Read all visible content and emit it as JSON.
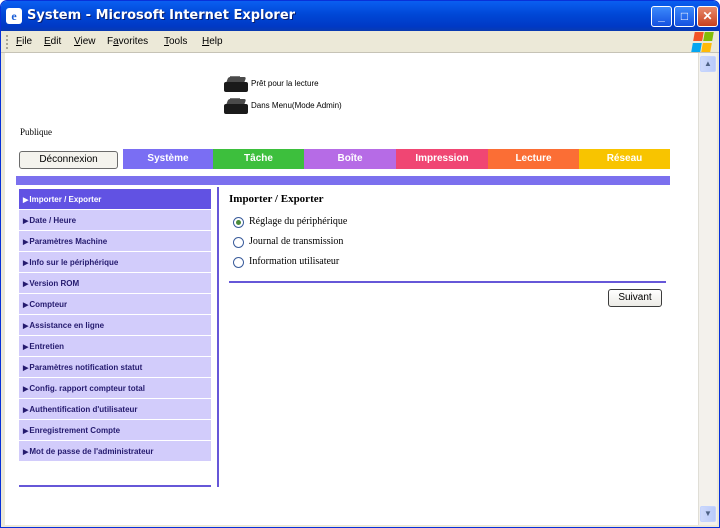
{
  "window": {
    "title": "System - Microsoft Internet Explorer",
    "icon": "ie-icon",
    "minimize": "_",
    "maximize": "□",
    "close": "✕"
  },
  "menu": [
    {
      "label": "File",
      "key": "F",
      "rest": "ile"
    },
    {
      "label": "Edit",
      "key": "E",
      "rest": "dit"
    },
    {
      "label": "View",
      "key": "V",
      "rest": "iew"
    },
    {
      "label": "Favorites",
      "key": "a",
      "pre": "F",
      "rest": "vorites"
    },
    {
      "label": "Tools",
      "key": "T",
      "rest": "ools"
    },
    {
      "label": "Help",
      "key": "H",
      "rest": "elp"
    }
  ],
  "status": {
    "ready": "Prêt pour la lecture",
    "mode": "Dans Menu(Mode Admin)"
  },
  "user_type": "Publique",
  "logout_label": "Déconnexion",
  "tabs": [
    {
      "label": "Système",
      "color": "#7a6ef3"
    },
    {
      "label": "Tâche",
      "color": "#3dbf3d"
    },
    {
      "label": "Boîte",
      "color": "#b66be6"
    },
    {
      "label": "Impression",
      "color": "#f04673"
    },
    {
      "label": "Lecture",
      "color": "#fb6e35"
    },
    {
      "label": "Réseau",
      "color": "#f8c400"
    }
  ],
  "sidebar": {
    "items": [
      {
        "label": "Importer / Exporter",
        "active": true
      },
      {
        "label": "Date / Heure"
      },
      {
        "label": "Paramètres Machine"
      },
      {
        "label": "Info sur le périphérique"
      },
      {
        "label": "Version ROM"
      },
      {
        "label": "Compteur"
      },
      {
        "label": "Assistance en ligne"
      },
      {
        "label": "Entretien"
      },
      {
        "label": "Paramètres notification statut"
      },
      {
        "label": "Config. rapport compteur total"
      },
      {
        "label": "Authentification d'utilisateur"
      },
      {
        "label": "Enregistrement Compte"
      },
      {
        "label": "Mot de passe de l'administrateur"
      }
    ]
  },
  "panel": {
    "title": "Importer / Exporter",
    "options": [
      {
        "label": "Réglage du périphérique",
        "selected": true
      },
      {
        "label": "Journal de transmission",
        "selected": false
      },
      {
        "label": "Information utilisateur",
        "selected": false
      }
    ],
    "next_label": "Suivant"
  },
  "colors": {
    "accent": "#6657d8",
    "sidebar_bg": "#d2ccfb",
    "sidebar_active": "#6152e3"
  }
}
